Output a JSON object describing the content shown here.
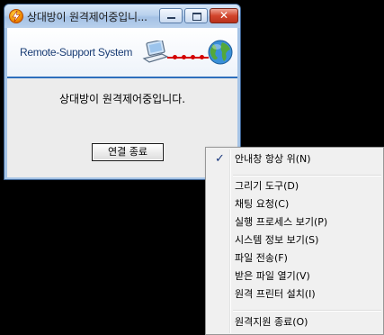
{
  "window": {
    "title": "상대방이 원격제어중입니...",
    "banner_text": "Remote-Support System",
    "message": "상대방이 원격제어중입니다.",
    "end_button": "연결 종료",
    "close_glyph": "✕"
  },
  "context_menu": {
    "checked_item": {
      "label": "안내창 항상 위(N)",
      "check": "✓",
      "checked": true
    },
    "items_group1": [
      "그리기 도구(D)",
      "채팅 요청(C)",
      "실행 프로세스 보기(P)",
      "시스템 정보 보기(S)",
      "파일 전송(F)",
      "받은 파일 열기(V)",
      "원격 프린터 설치(I)"
    ],
    "last_item": "원격지원 종료(O)"
  },
  "colors": {
    "banner_text": "#1a3d75",
    "accent_line": "#2e6fbd",
    "connector": "#d40000"
  }
}
